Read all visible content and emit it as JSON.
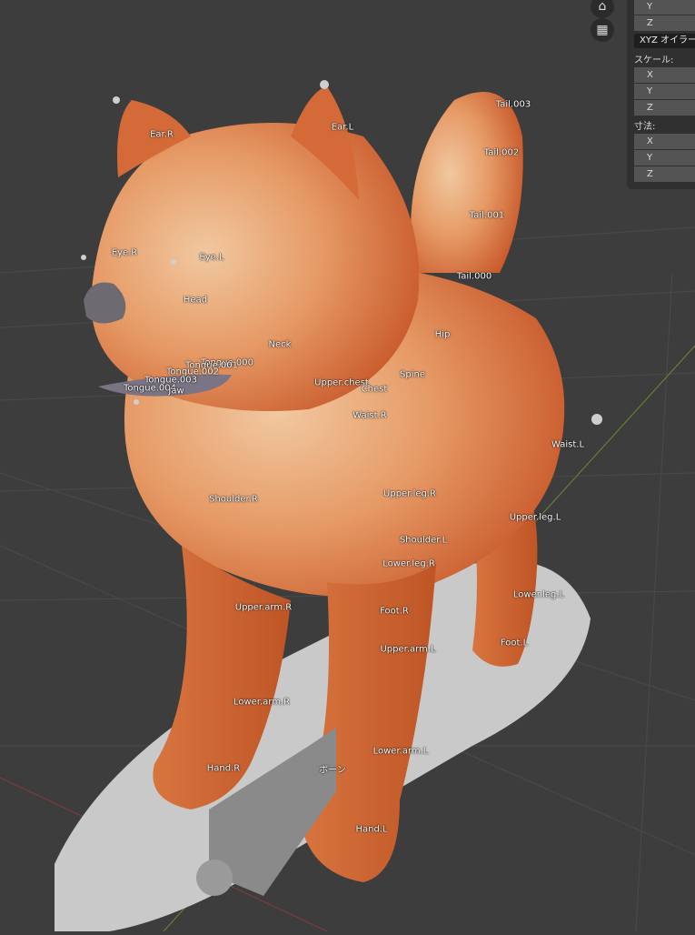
{
  "panel": {
    "rotation_axes": [
      "Y",
      "Z"
    ],
    "rotation_mode": "XYZ オイラー",
    "scale_label": "スケール:",
    "scale_axes": [
      "X",
      "Y",
      "Z"
    ],
    "dimensions_label": "寸法:",
    "dimensions_axes": [
      "X",
      "Y",
      "Z"
    ]
  },
  "gizmos": {
    "camera": "camera-icon",
    "grid": "grid-icon"
  },
  "bones": {
    "ear_r": "Ear.R",
    "ear_l": "Ear.L",
    "tail_003": "Tail.003",
    "tail_002": "Tail.002",
    "tail_001": "Tail.001",
    "tail_000": "Tail.000",
    "eye_r": "Eye.R",
    "eye_l": "Eye.L",
    "head": "Head",
    "neck": "Neck",
    "hip": "Hip",
    "tongue_000": "Tongue.000",
    "tongue_001": "Tongue.001",
    "tongue_002": "Tongue.002",
    "tongue_003": "Tongue.003",
    "tongue_004": "Tongue.004",
    "jaw": "Jaw",
    "upper_chest": "Upper.chest",
    "spine": "Spine",
    "chest": "Chest",
    "waist_r": "Waist.R",
    "waist_l": "Waist.L",
    "shoulder_r": "Shoulder.R",
    "upper_leg_r": "Upper.leg.R",
    "upper_leg_l": "Upper.leg.L",
    "shoulder_l": "Shoulder.L",
    "lower_leg_r": "Lower.leg.R",
    "upper_arm_r": "Upper.arm.R",
    "foot_r": "Foot.R",
    "lower_leg_l": "Lower.leg.L",
    "foot_l": "Foot.L",
    "upper_arm_l": "Upper.arm.L",
    "lower_arm_r": "Lower.arm.R",
    "lower_arm_l": "Lower.arm.L",
    "hand_r": "Hand.R",
    "root": "ボーン",
    "hand_l": "Hand.L"
  }
}
